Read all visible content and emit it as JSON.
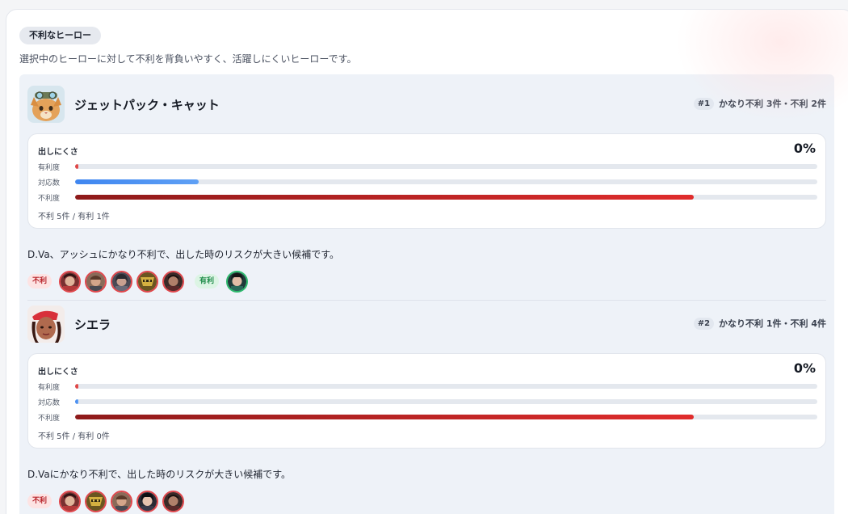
{
  "section": {
    "badge": "不利なヒーロー",
    "description": "選択中のヒーローに対して不利を背負いやすく、活躍しにくいヒーローです。"
  },
  "cards": [
    {
      "name": "ジェットパック・キャット",
      "avatar_icon": "jetpack-cat-portrait",
      "rank": "#1",
      "rank_summary": "かなり不利 3件・不利 2件",
      "metric_title": "出しにくさ",
      "metric_value": "0%",
      "bars": [
        {
          "label": "有利度",
          "fraction": 0.004,
          "kind": "adv"
        },
        {
          "label": "対応数",
          "fraction": 0.166,
          "kind": "resp"
        },
        {
          "label": "不利度",
          "fraction": 0.834,
          "kind": "dis"
        }
      ],
      "footer": "不利 5件 / 有利 1件",
      "description": "D.Va、アッシュにかなり不利で、出した時のリスクが大きい候補です。",
      "tag_disadvantage": "不利",
      "tag_advantage": "有利",
      "disadvantage_heroes": [
        "hero-portrait-1",
        "hero-portrait-2",
        "hero-portrait-3",
        "hero-portrait-4",
        "hero-portrait-5"
      ],
      "advantage_heroes": [
        "hero-portrait-6"
      ]
    },
    {
      "name": "シエラ",
      "avatar_icon": "sierra-portrait",
      "rank": "#2",
      "rank_summary": "かなり不利 1件・不利 4件",
      "metric_title": "出しにくさ",
      "metric_value": "0%",
      "bars": [
        {
          "label": "有利度",
          "fraction": 0.004,
          "kind": "adv"
        },
        {
          "label": "対応数",
          "fraction": 0.004,
          "kind": "resp"
        },
        {
          "label": "不利度",
          "fraction": 0.834,
          "kind": "dis"
        }
      ],
      "footer": "不利 5件 / 有利 0件",
      "description": "D.Vaにかなり不利で、出した時のリスクが大きい候補です。",
      "tag_disadvantage": "不利",
      "tag_advantage": "",
      "disadvantage_heroes": [
        "hero-portrait-1",
        "hero-portrait-4",
        "hero-portrait-2",
        "hero-portrait-7",
        "hero-portrait-5"
      ],
      "advantage_heroes": []
    }
  ],
  "colors": {
    "advantage_bar": "#e04848",
    "response_bar": "#3f86f0",
    "disadvantage_bar": "#c62222",
    "disadvantage_tag": "#b8232a",
    "advantage_tag": "#1f8c4a"
  }
}
